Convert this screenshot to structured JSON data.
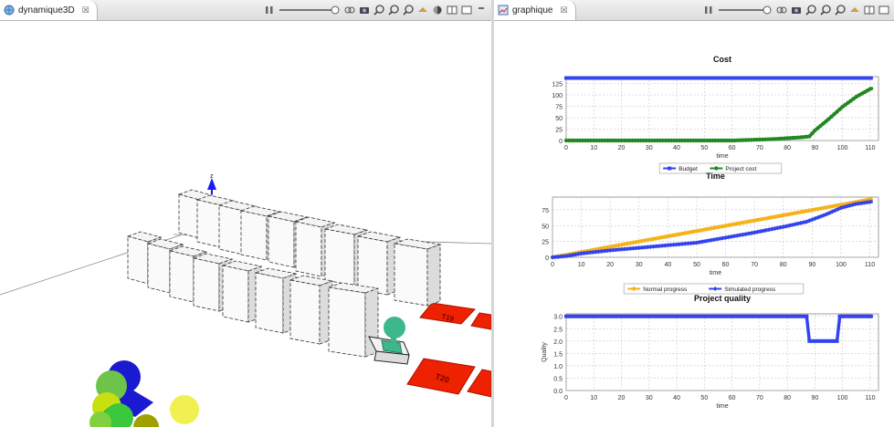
{
  "left_view": {
    "tab_label": "dynamique3D",
    "close_glyph": "☒",
    "z_axis_label": "z",
    "task_tiles": [
      "T19",
      "T20"
    ]
  },
  "right_view": {
    "tab_label": "graphique",
    "close_glyph": "☒"
  },
  "colors": {
    "budget": "#3344ee",
    "project_cost": "#228822",
    "normal_progress": "#f5b21a",
    "simulated_progress": "#3344ee",
    "quality": "#3344ee",
    "task_tile": "#ee2200"
  },
  "chart_data": [
    {
      "type": "line",
      "title": "Cost",
      "xlabel": "time",
      "ylabel": "",
      "xlim": [
        0,
        113
      ],
      "ylim": [
        0,
        140
      ],
      "xticks": [
        0,
        10,
        20,
        30,
        40,
        50,
        60,
        70,
        80,
        90,
        100,
        110
      ],
      "yticks": [
        0,
        25,
        50,
        75,
        100,
        125
      ],
      "legend_position": "bottom",
      "series": [
        {
          "name": "Budget",
          "marker": "square",
          "x": [
            0,
            111
          ],
          "y": [
            137,
            137
          ]
        },
        {
          "name": "Project cost",
          "marker": "circle",
          "x": [
            0,
            60,
            65,
            70,
            75,
            80,
            85,
            88,
            90,
            95,
            100,
            105,
            110,
            111
          ],
          "y": [
            0,
            0,
            1,
            2,
            3,
            5,
            7,
            9,
            22,
            47,
            74,
            96,
            113,
            115
          ]
        }
      ]
    },
    {
      "type": "line",
      "title": "Time",
      "xlabel": "time",
      "ylabel": "",
      "xlim": [
        0,
        113
      ],
      "ylim": [
        0,
        95
      ],
      "xticks": [
        0,
        10,
        20,
        30,
        40,
        50,
        60,
        70,
        80,
        90,
        100,
        110
      ],
      "yticks": [
        0,
        25,
        50,
        75
      ],
      "legend_position": "bottom",
      "series": [
        {
          "name": "Normal progress",
          "marker": "circle",
          "x": [
            0,
            111
          ],
          "y": [
            0,
            92
          ]
        },
        {
          "name": "Simulated progress",
          "marker": "diamond",
          "x": [
            0,
            5,
            10,
            20,
            30,
            40,
            50,
            60,
            70,
            80,
            88,
            95,
            100,
            105,
            111
          ],
          "y": [
            0,
            2,
            6,
            11,
            15,
            19,
            23,
            31,
            39,
            48,
            56,
            68,
            78,
            84,
            88
          ]
        }
      ]
    },
    {
      "type": "line",
      "title": "Project quality",
      "xlabel": "time",
      "ylabel": "Quality",
      "xlim": [
        0,
        113
      ],
      "ylim": [
        0,
        3.1
      ],
      "xticks": [
        0,
        10,
        20,
        30,
        40,
        50,
        60,
        70,
        80,
        90,
        100,
        110
      ],
      "yticks": [
        0.0,
        0.5,
        1.0,
        1.5,
        2.0,
        2.5,
        3.0
      ],
      "series": [
        {
          "name": "",
          "marker": "square",
          "x": [
            0,
            87,
            88,
            98,
            99,
            111
          ],
          "y": [
            3.0,
            3.0,
            2.0,
            2.0,
            3.0,
            3.0
          ]
        }
      ]
    }
  ]
}
